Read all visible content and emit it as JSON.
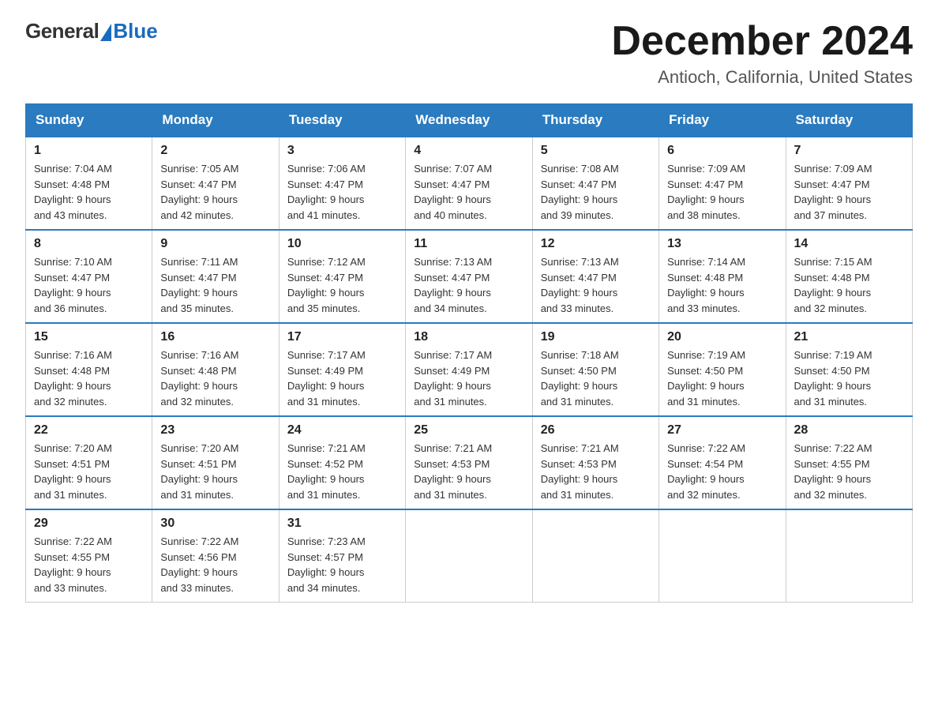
{
  "logo": {
    "general": "General",
    "blue": "Blue"
  },
  "title": "December 2024",
  "subtitle": "Antioch, California, United States",
  "days_of_week": [
    "Sunday",
    "Monday",
    "Tuesday",
    "Wednesday",
    "Thursday",
    "Friday",
    "Saturday"
  ],
  "weeks": [
    [
      {
        "day": "1",
        "sunrise": "7:04 AM",
        "sunset": "4:48 PM",
        "daylight": "9 hours and 43 minutes."
      },
      {
        "day": "2",
        "sunrise": "7:05 AM",
        "sunset": "4:47 PM",
        "daylight": "9 hours and 42 minutes."
      },
      {
        "day": "3",
        "sunrise": "7:06 AM",
        "sunset": "4:47 PM",
        "daylight": "9 hours and 41 minutes."
      },
      {
        "day": "4",
        "sunrise": "7:07 AM",
        "sunset": "4:47 PM",
        "daylight": "9 hours and 40 minutes."
      },
      {
        "day": "5",
        "sunrise": "7:08 AM",
        "sunset": "4:47 PM",
        "daylight": "9 hours and 39 minutes."
      },
      {
        "day": "6",
        "sunrise": "7:09 AM",
        "sunset": "4:47 PM",
        "daylight": "9 hours and 38 minutes."
      },
      {
        "day": "7",
        "sunrise": "7:09 AM",
        "sunset": "4:47 PM",
        "daylight": "9 hours and 37 minutes."
      }
    ],
    [
      {
        "day": "8",
        "sunrise": "7:10 AM",
        "sunset": "4:47 PM",
        "daylight": "9 hours and 36 minutes."
      },
      {
        "day": "9",
        "sunrise": "7:11 AM",
        "sunset": "4:47 PM",
        "daylight": "9 hours and 35 minutes."
      },
      {
        "day": "10",
        "sunrise": "7:12 AM",
        "sunset": "4:47 PM",
        "daylight": "9 hours and 35 minutes."
      },
      {
        "day": "11",
        "sunrise": "7:13 AM",
        "sunset": "4:47 PM",
        "daylight": "9 hours and 34 minutes."
      },
      {
        "day": "12",
        "sunrise": "7:13 AM",
        "sunset": "4:47 PM",
        "daylight": "9 hours and 33 minutes."
      },
      {
        "day": "13",
        "sunrise": "7:14 AM",
        "sunset": "4:48 PM",
        "daylight": "9 hours and 33 minutes."
      },
      {
        "day": "14",
        "sunrise": "7:15 AM",
        "sunset": "4:48 PM",
        "daylight": "9 hours and 32 minutes."
      }
    ],
    [
      {
        "day": "15",
        "sunrise": "7:16 AM",
        "sunset": "4:48 PM",
        "daylight": "9 hours and 32 minutes."
      },
      {
        "day": "16",
        "sunrise": "7:16 AM",
        "sunset": "4:48 PM",
        "daylight": "9 hours and 32 minutes."
      },
      {
        "day": "17",
        "sunrise": "7:17 AM",
        "sunset": "4:49 PM",
        "daylight": "9 hours and 31 minutes."
      },
      {
        "day": "18",
        "sunrise": "7:17 AM",
        "sunset": "4:49 PM",
        "daylight": "9 hours and 31 minutes."
      },
      {
        "day": "19",
        "sunrise": "7:18 AM",
        "sunset": "4:50 PM",
        "daylight": "9 hours and 31 minutes."
      },
      {
        "day": "20",
        "sunrise": "7:19 AM",
        "sunset": "4:50 PM",
        "daylight": "9 hours and 31 minutes."
      },
      {
        "day": "21",
        "sunrise": "7:19 AM",
        "sunset": "4:50 PM",
        "daylight": "9 hours and 31 minutes."
      }
    ],
    [
      {
        "day": "22",
        "sunrise": "7:20 AM",
        "sunset": "4:51 PM",
        "daylight": "9 hours and 31 minutes."
      },
      {
        "day": "23",
        "sunrise": "7:20 AM",
        "sunset": "4:51 PM",
        "daylight": "9 hours and 31 minutes."
      },
      {
        "day": "24",
        "sunrise": "7:21 AM",
        "sunset": "4:52 PM",
        "daylight": "9 hours and 31 minutes."
      },
      {
        "day": "25",
        "sunrise": "7:21 AM",
        "sunset": "4:53 PM",
        "daylight": "9 hours and 31 minutes."
      },
      {
        "day": "26",
        "sunrise": "7:21 AM",
        "sunset": "4:53 PM",
        "daylight": "9 hours and 31 minutes."
      },
      {
        "day": "27",
        "sunrise": "7:22 AM",
        "sunset": "4:54 PM",
        "daylight": "9 hours and 32 minutes."
      },
      {
        "day": "28",
        "sunrise": "7:22 AM",
        "sunset": "4:55 PM",
        "daylight": "9 hours and 32 minutes."
      }
    ],
    [
      {
        "day": "29",
        "sunrise": "7:22 AM",
        "sunset": "4:55 PM",
        "daylight": "9 hours and 33 minutes."
      },
      {
        "day": "30",
        "sunrise": "7:22 AM",
        "sunset": "4:56 PM",
        "daylight": "9 hours and 33 minutes."
      },
      {
        "day": "31",
        "sunrise": "7:23 AM",
        "sunset": "4:57 PM",
        "daylight": "9 hours and 34 minutes."
      },
      null,
      null,
      null,
      null
    ]
  ],
  "labels": {
    "sunrise": "Sunrise:",
    "sunset": "Sunset:",
    "daylight": "Daylight:"
  }
}
